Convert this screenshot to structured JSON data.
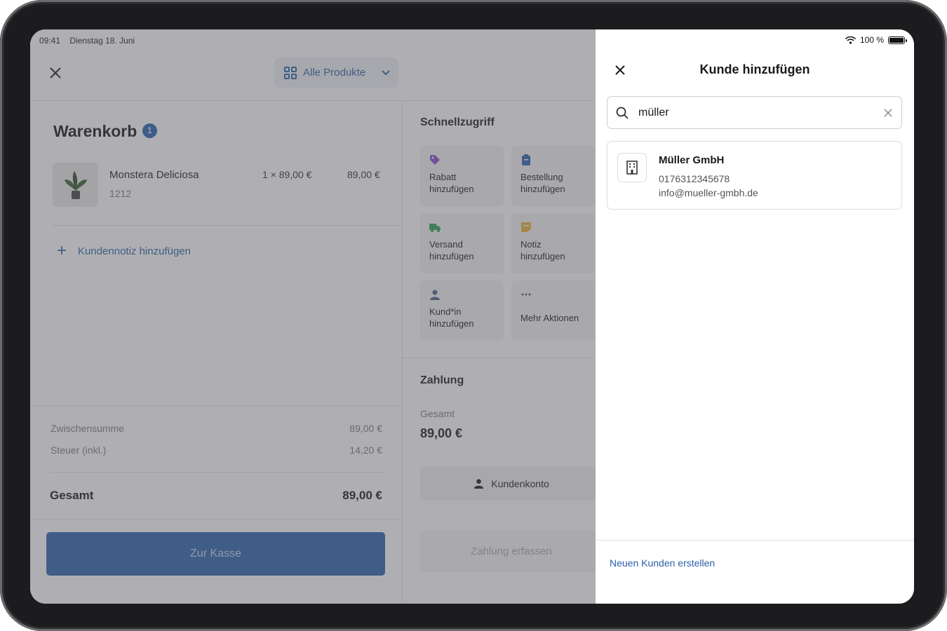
{
  "status": {
    "time": "09:41",
    "date": "Dienstag 18. Juni",
    "battery": "100 %"
  },
  "toolbar": {
    "products_label": "Alle Produkte"
  },
  "cart": {
    "title": "Warenkorb",
    "badge_count": "1",
    "item": {
      "name": "Monstera Deliciosa",
      "sku": "1212",
      "quantity_price": "1 × 89,00 €",
      "total": "89,00 €"
    },
    "add_note_label": "Kundennotiz hinzufügen",
    "subtotal_label": "Zwischensumme",
    "subtotal_value": "89,00 €",
    "tax_label": "Steuer (inkl.)",
    "tax_value": "14,20 €",
    "total_label": "Gesamt",
    "total_value": "89,00 €",
    "checkout_label": "Zur Kasse"
  },
  "quick_access": {
    "title": "Schnellzugriff",
    "tiles": [
      {
        "label": "Rabatt hinzufügen",
        "icon": "tag-icon",
        "color": "#7b4fc4"
      },
      {
        "label": "Bestellung hinzufügen",
        "icon": "clipboard-icon",
        "color": "#2f5ea8"
      },
      {
        "label": "Versand hinzufügen",
        "icon": "truck-icon",
        "color": "#2f9a5a"
      },
      {
        "label": "Notiz hinzufügen",
        "icon": "note-icon",
        "color": "#d9a53a"
      },
      {
        "label": "Kund*in hinzufügen",
        "icon": "person-icon",
        "color": "#4a5f7f"
      },
      {
        "label": "Mehr Aktionen",
        "icon": "more-icon",
        "color": "#555555"
      }
    ]
  },
  "payment": {
    "title": "Zahlung",
    "total_label": "Gesamt",
    "total_value": "89,00 €",
    "account_label": "Kundenkonto",
    "capture_label": "Zahlung erfassen"
  },
  "sheet": {
    "title": "Kunde hinzufügen",
    "search_value": "müller",
    "result": {
      "name": "Müller GmbH",
      "phone": "0176312345678",
      "email": "info@mueller-gmbh.de"
    },
    "new_customer_label": "Neuen Kunden erstellen"
  },
  "colors": {
    "accent": "#2d5fa5",
    "link": "#2d62a9"
  }
}
